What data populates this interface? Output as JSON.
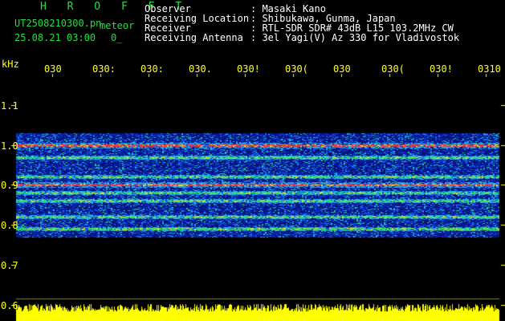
{
  "app": {
    "title": "H R O F F T",
    "filename": "UT2508210300.pn",
    "meteor_label": "meteor",
    "datetime": "25.08.21 03:00",
    "meteor_count": "0_"
  },
  "info": {
    "rows": [
      {
        "label": "Observer",
        "value": ": Masaki Kano"
      },
      {
        "label": "Receiving Location",
        "value": ": Shibukawa, Gunma, Japan"
      },
      {
        "label": "Receiver",
        "value": ": RTL-SDR SDR# 43dB L15 103.2MHz CW"
      },
      {
        "label": "Receiving Antenna",
        "value": ": 3el Yagi(V) Az 330 for Vladivostok"
      }
    ]
  },
  "axes": {
    "y_unit": "kHz",
    "y_ticks": [
      "1.1",
      "1.0",
      "0.9",
      "0.8",
      "0.7",
      "0.6"
    ],
    "x_ticks": [
      "030",
      "030:",
      "030:",
      "030.",
      "030!",
      "030(",
      "030",
      "030(",
      "030!",
      "0310"
    ]
  },
  "colors": {
    "text": "#ffffff",
    "title": "#20e040",
    "ticks": "#ffff20",
    "spectrum_bg": "#0a1a9a",
    "noise": "#ffff00"
  },
  "spectrogram": {
    "y_range_khz": [
      0.6,
      1.1
    ],
    "band_khz": [
      0.77,
      1.03
    ],
    "lines_khz": [
      1.0,
      0.97,
      0.92,
      0.9,
      0.88,
      0.86,
      0.82,
      0.79
    ]
  }
}
